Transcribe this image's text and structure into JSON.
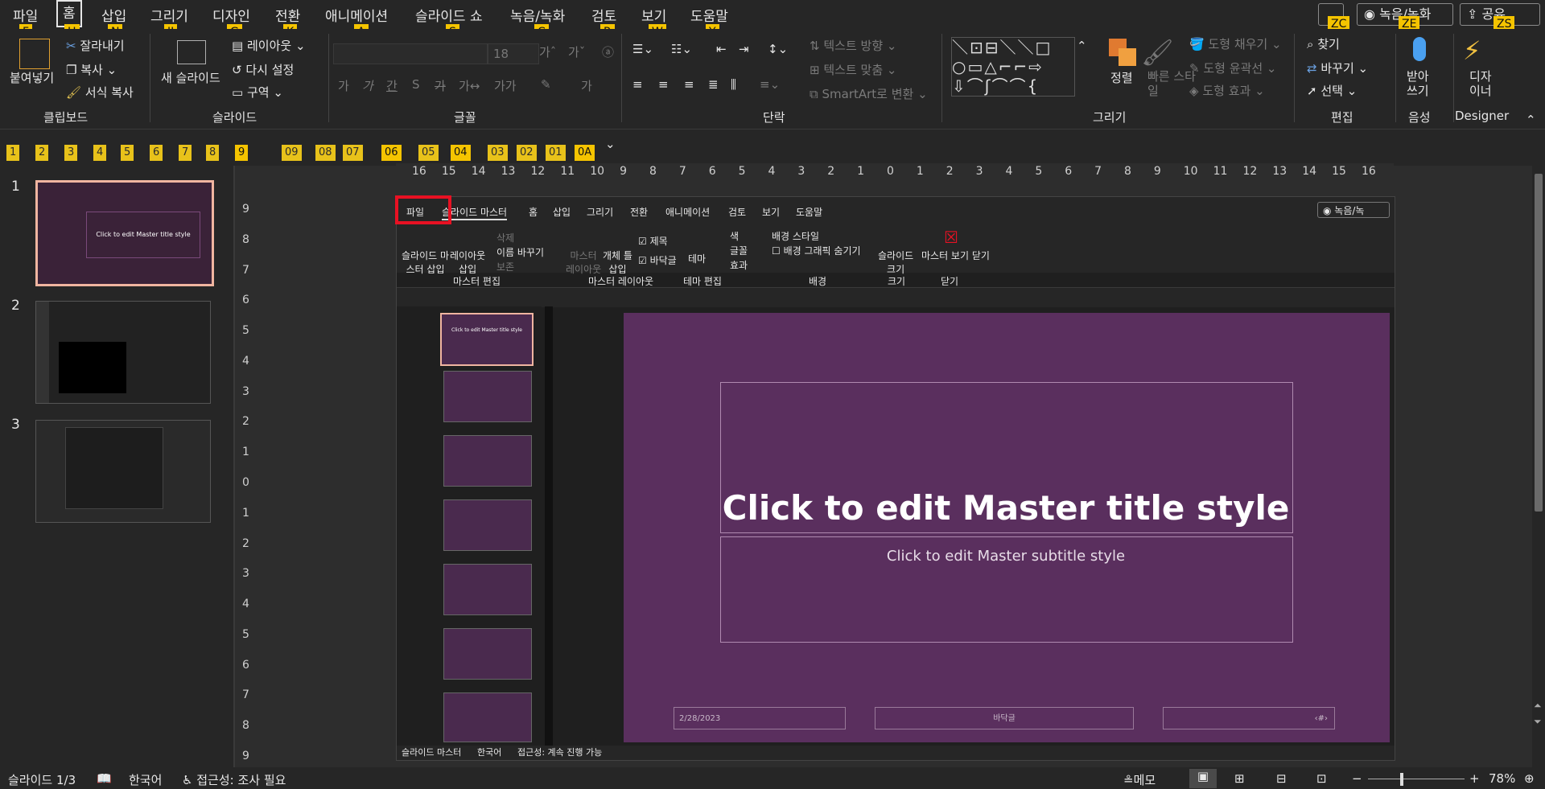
{
  "menu": {
    "items": [
      "파일",
      "홈",
      "삽입",
      "그리기",
      "디자인",
      "전환",
      "애니메이션",
      "슬라이드 쇼",
      "녹음/녹화",
      "검토",
      "보기",
      "도움말"
    ],
    "active": "홈",
    "keytips": [
      "F",
      "H",
      "N",
      "JI",
      "G",
      "K",
      "A",
      "S",
      "C",
      "R",
      "W",
      "Y"
    ],
    "record_button": "녹음/녹화",
    "share_button": "공유",
    "right_keytips": [
      "ZC",
      "ZE",
      "ZS"
    ]
  },
  "ribbon": {
    "clipboard": {
      "paste": "붙여넣기",
      "cut": "잘라내기",
      "copy": "복사",
      "format_painter": "서식 복사",
      "label": "클립보드"
    },
    "slides": {
      "new_slide": "새 슬라이드",
      "layout": "레이아웃",
      "reset": "다시 설정",
      "section": "구역",
      "label": "슬라이드"
    },
    "font": {
      "size": "18",
      "label": "글꼴"
    },
    "paragraph": {
      "text_direction": "텍스트 방향",
      "align_text": "텍스트 맞춤",
      "smartart": "SmartArt로 변환",
      "label": "단락"
    },
    "drawing": {
      "arrange": "정렬",
      "quick_styles": "빠른 스타일",
      "shape_fill": "도형 채우기",
      "shape_outline": "도형 윤곽선",
      "shape_effects": "도형 효과",
      "label": "그리기"
    },
    "editing": {
      "find": "찾기",
      "replace": "바꾸기",
      "select": "선택",
      "label": "편집"
    },
    "voice": {
      "dictate": "받아 쓰기",
      "label": "음성"
    },
    "designer": {
      "button": "디자 이너",
      "label": "Designer"
    }
  },
  "qat_keytips": [
    "1",
    "2",
    "3",
    "4",
    "5",
    "6",
    "7",
    "8",
    "9",
    "09",
    "08",
    "07",
    "06",
    "05",
    "04",
    "03",
    "02",
    "01",
    "0A"
  ],
  "slides_panel": {
    "numbers": [
      "1",
      "2",
      "3"
    ],
    "thumb1_title": "Click to edit Master title style"
  },
  "ruler": {
    "h_ticks": [
      "16",
      "15",
      "14",
      "13",
      "12",
      "11",
      "10",
      "9",
      "8",
      "7",
      "6",
      "5",
      "4",
      "3",
      "2",
      "1",
      "0",
      "1",
      "2",
      "3",
      "4",
      "5",
      "6",
      "7",
      "8",
      "9",
      "10",
      "11",
      "12",
      "13",
      "14",
      "15",
      "16"
    ],
    "v_ticks": [
      "9",
      "8",
      "7",
      "6",
      "5",
      "4",
      "3",
      "2",
      "1",
      "0",
      "1",
      "2",
      "3",
      "4",
      "5",
      "6",
      "7",
      "8",
      "9"
    ]
  },
  "inner_window": {
    "tabs": [
      "파일",
      "슬라이드 마스터",
      "홈",
      "삽입",
      "그리기",
      "전환",
      "애니메이션",
      "검토",
      "보기",
      "도움말"
    ],
    "record": "녹음/녹",
    "ribbon": {
      "insert_master": "슬라이드 마\n스터 삽입",
      "insert_layout": "레이아웃\n삽입",
      "delete": "삭제",
      "rename": "이름 바꾸기",
      "preserve": "보존",
      "master_layout": "마스터\n레이아웃",
      "placeholder": "개체 틀\n삽입",
      "title_check": "제목",
      "footer_check": "바닥글",
      "themes": "테마",
      "colors": "색",
      "fonts": "글꼴",
      "effects": "효과",
      "bg_styles": "배경 스타일",
      "hide_bg": "배경 그래픽 숨기기",
      "slide_size": "슬라이드\n크기",
      "close_master": "마스터 보기 닫기",
      "g_master_edit": "마스터 편집",
      "g_master_layout": "마스터 레이아웃",
      "g_theme_edit": "테마 편집",
      "g_background": "배경",
      "g_size": "크기",
      "g_close": "닫기"
    },
    "slide": {
      "title": "Click to edit Master title style",
      "subtitle": "Click to edit Master subtitle style",
      "date": "2/28/2023",
      "footer": "바닥글",
      "page": "‹#›"
    },
    "layout_thumb_title": "Click to edit Master title style",
    "status": {
      "view": "슬라이드 마스터",
      "lang": "한국어",
      "access": "접근성: 계속 진행 가능"
    }
  },
  "status": {
    "slide": "슬라이드 1/3",
    "lang": "한국어",
    "accessibility": "접근성: 조사 필요",
    "notes": "메모",
    "zoom": "78%"
  },
  "colors": {
    "accent_red": "#e81123",
    "keytip": "#f5c400",
    "slide_bg": "#5a2f5e"
  }
}
